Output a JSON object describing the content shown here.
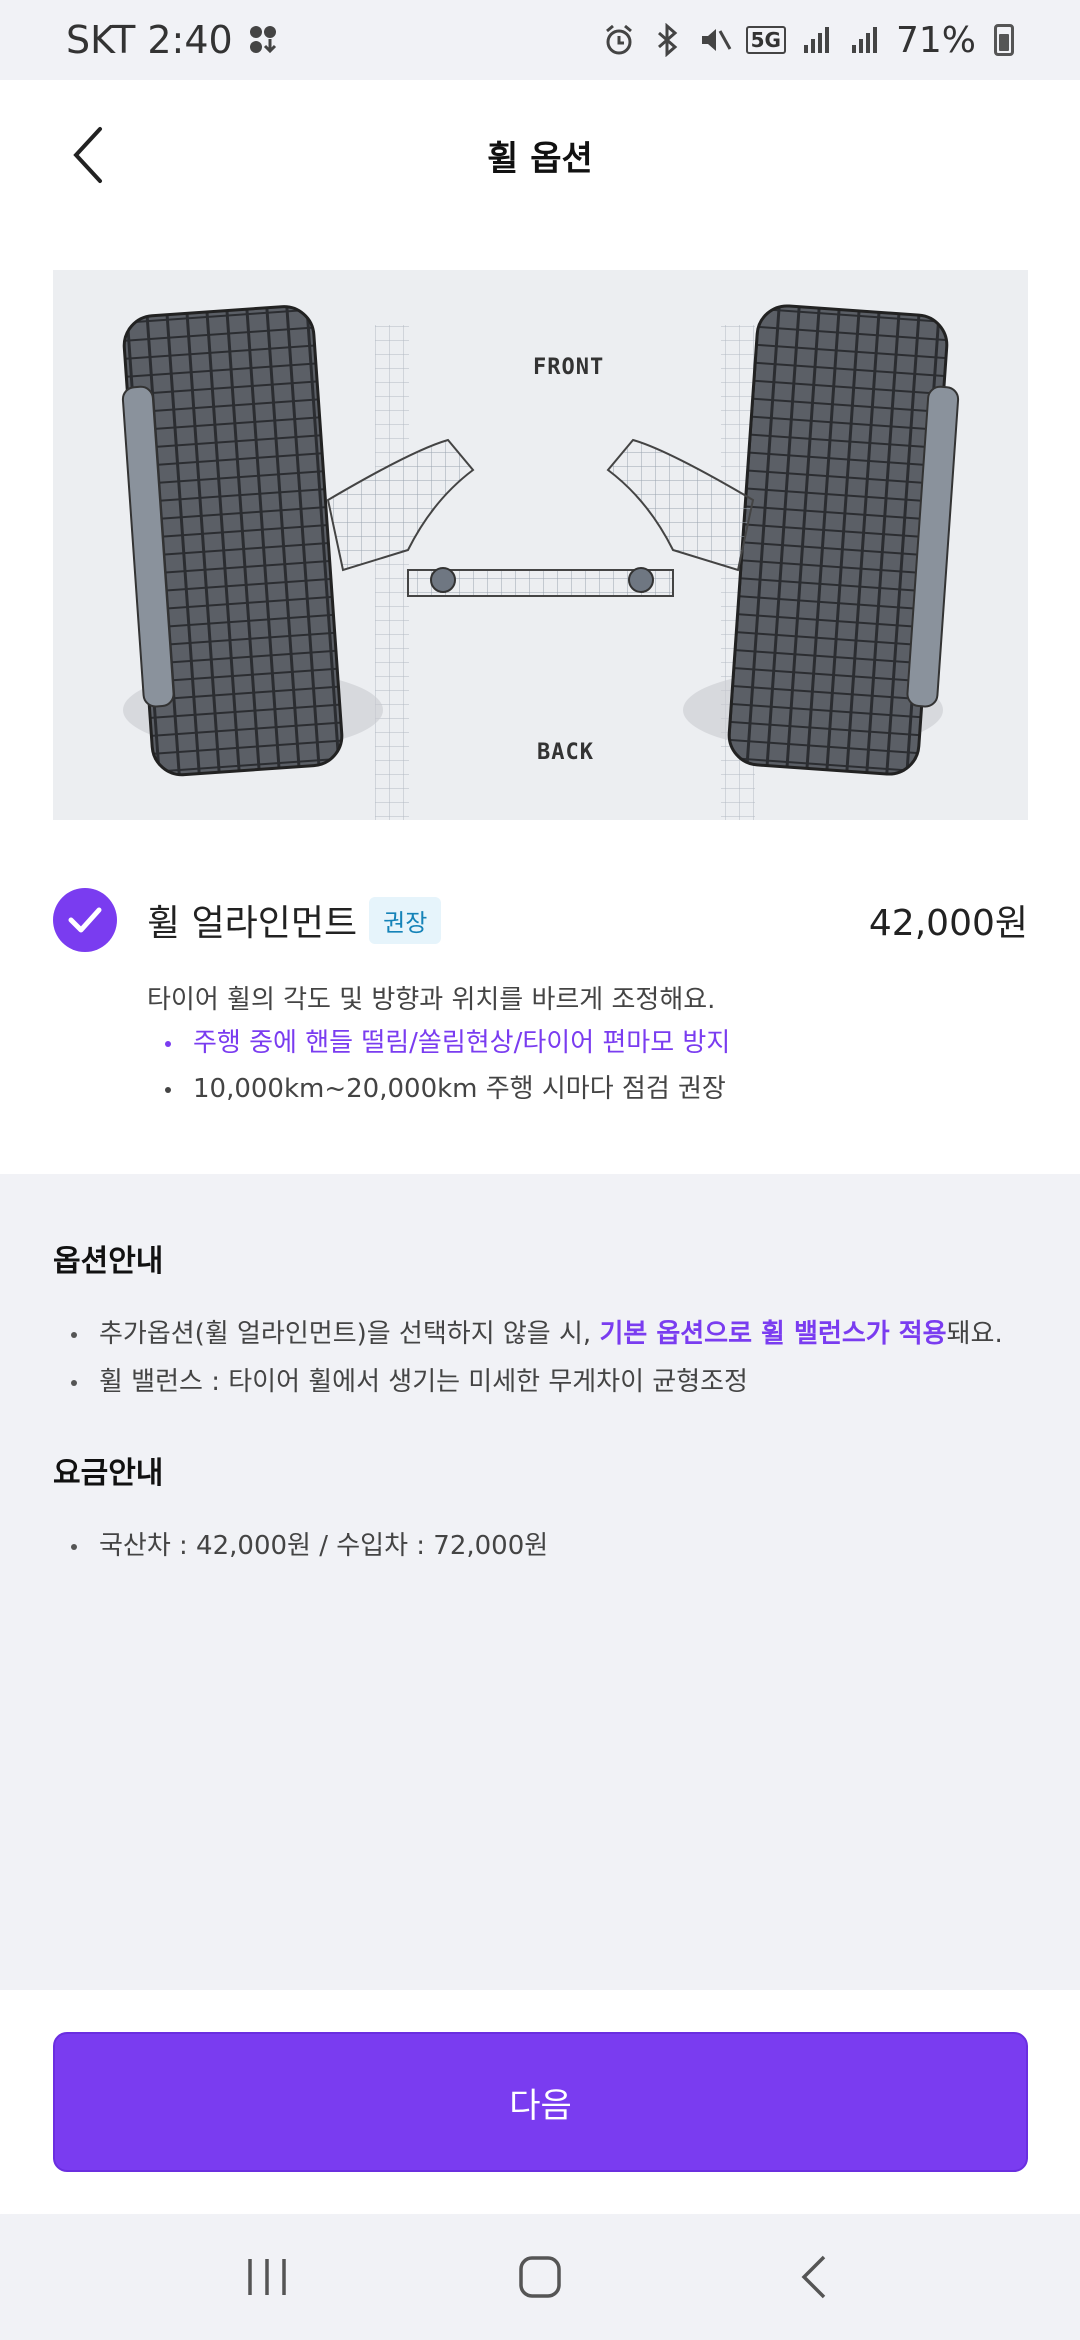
{
  "status_bar": {
    "carrier_time": "SKT 2:40",
    "network": "5G",
    "battery": "71%"
  },
  "header": {
    "title": "휠 옵션",
    "back_icon": "chevron-left-icon"
  },
  "hero": {
    "front_label": "FRONT",
    "back_label": "BACK"
  },
  "option": {
    "selected": true,
    "name": "휠 얼라인먼트",
    "badge": "권장",
    "price": "42,000원",
    "description": "타이어 휠의 각도 및 방향과 위치를 바르게 조정해요.",
    "points": [
      "주행 중에 핸들 떨림/쏠림현상/타이어 편마모 방지",
      "10,000km~20,000km 주행 시마다 점검 권장"
    ]
  },
  "option_guide": {
    "title": "옵션안내",
    "item1_prefix": "추가옵션(휠 얼라인먼트)을 선택하지 않을 시, ",
    "item1_highlight": "기본 옵션으로 휠 밸런스가 적용",
    "item1_suffix": "돼요.",
    "item2": "휠 밸런스 : 타이어 휠에서 생기는 미세한 무게차이 균형조정"
  },
  "fee_guide": {
    "title": "요금안내",
    "item1": "국산차 : 42,000원 / 수입차 : 72,000원"
  },
  "footer": {
    "next_label": "다음"
  },
  "colors": {
    "accent": "#7a3cf0",
    "badge_bg": "#e6f4fb",
    "badge_text": "#1583b8",
    "background": "#f1f2f6"
  }
}
